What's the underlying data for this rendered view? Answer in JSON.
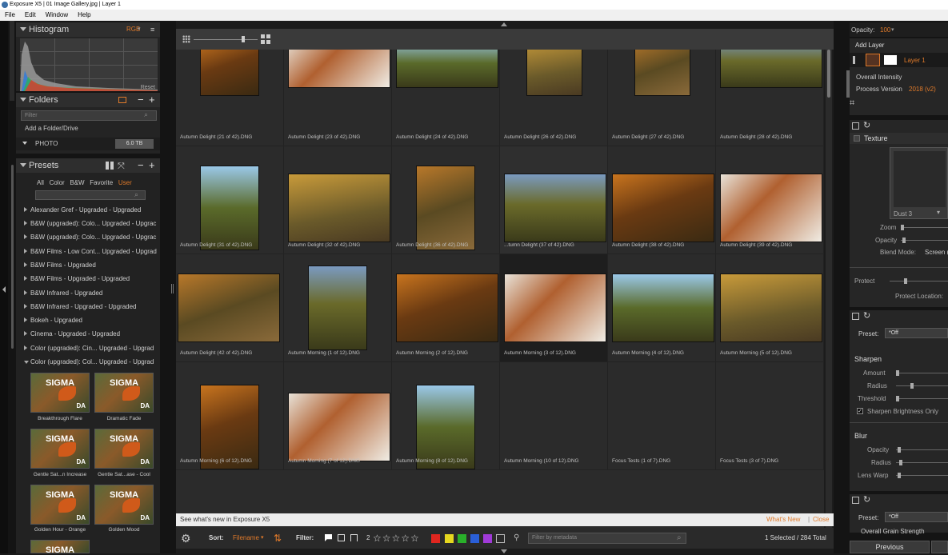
{
  "window": {
    "title": "Exposure X5 | 01 Image Gallery.jpg | Layer 1"
  },
  "menu": [
    "File",
    "Edit",
    "Window",
    "Help"
  ],
  "histogram": {
    "title": "Histogram",
    "mode": "RGB",
    "reset": "Reset"
  },
  "folders": {
    "title": "Folders",
    "filter_placeholder": "Filter",
    "add": "Add a Folder/Drive",
    "drive_name": "PHOTO",
    "drive_size": "6.0 TB"
  },
  "presets": {
    "title": "Presets",
    "tabs": [
      "All",
      "Color",
      "B&W",
      "Favorite",
      "User"
    ],
    "groups": [
      "Alexander Gref - Upgraded - Upgraded",
      "B&W (upgraded): Colo... Upgraded - Upgrac",
      "B&W (upgraded): Colo... Upgraded - Upgrac",
      "B&W Films - Low Cont... Upgraded - Upgrad",
      "B&W Films - Upgraded",
      "B&W Films - Upgraded - Upgraded",
      "B&W Infrared - Upgraded",
      "B&W Infrared - Upgraded - Upgraded",
      "Bokeh - Upgraded",
      "Cinema - Upgraded - Upgraded",
      "Color (upgraded): Cin... Upgraded - Upgrad",
      "Color (upgraded): Col... Upgraded - Upgrad"
    ],
    "thumbs": [
      {
        "label": "Breakthrough Flare"
      },
      {
        "label": "Dramatic Fade"
      },
      {
        "label": "Gentle Sat...n Increase"
      },
      {
        "label": "Gentle Sat...ase - Cool"
      },
      {
        "label": "Golden Hour - Orange"
      },
      {
        "label": "Golden Mood"
      }
    ],
    "thumb_text": {
      "brand": "SIGMA",
      "badge": "DA"
    }
  },
  "grid": {
    "rows": [
      [
        "Autumn Delight (21 of 42).DNG",
        "Autumn Delight (23 of 42).DNG",
        "Autumn Delight (24 of 42).DNG",
        "Autumn Delight (26 of 42).DNG",
        "Autumn Delight (27 of 42).DNG",
        "Autumn Delight (28 of 42).DNG"
      ],
      [
        "Autumn Delight (31 of 42).DNG",
        "Autumn Delight (32 of 42).DNG",
        "Autumn Delight (36 of 42).DNG",
        "...tumn Delight (37 of 42).DNG",
        "Autumn Delight (38 of 42).DNG",
        "Autumn Delight (39 of 42).DNG"
      ],
      [
        "Autumn Delight (42 of 42).DNG",
        "Autumn Morning (1 of 12).DNG",
        "Autumn Morning (2 of 12).DNG",
        "Autumn Morning (3 of 12).DNG",
        "Autumn Morning (4 of 12).DNG",
        "Autumn Morning (5 of 12).DNG"
      ],
      [
        "Autumn Morning (6 of 12).DNG",
        "Autumn Morning (7 of 12).DNG",
        "Autumn Morning (8 of 12).DNG",
        "Autumn Morning (10 of 12).DNG",
        "Focus Tests (1 of 7).DNG",
        "Focus Tests (3 of 7).DNG"
      ]
    ],
    "stars": "☆☆☆☆☆"
  },
  "news": {
    "text": "See what's new in Exposure X5",
    "link": "What's New",
    "close": "Close"
  },
  "bottom": {
    "sort_label": "Sort:",
    "sort_value": "Filename",
    "filter_label": "Filter:",
    "rating_count": "2",
    "stars": "☆☆☆☆☆",
    "meta_placeholder": "Filter by metadata",
    "status": "1 Selected / 284 Total",
    "colors": [
      "#e0261f",
      "#e5d71f",
      "#29b02a",
      "#2a5fd8",
      "#a03ad8"
    ]
  },
  "right": {
    "opacity_label": "Opacity:",
    "opacity_value": "100",
    "add_layer": "Add Layer",
    "layer_name": "Layer 1",
    "overall_intensity": "Overall Intensity",
    "process_version": "Process Version",
    "process_value": "2018 (v2)",
    "texture": {
      "title": "Texture",
      "preset": "Dust 3",
      "zoom": "Zoom",
      "opacity": "Opacity",
      "blend_label": "Blend Mode:",
      "blend_value": "Screen (I",
      "protect": "Protect",
      "protect_location": "Protect Location:"
    },
    "preset_label": "Preset:",
    "preset_value": "*Off",
    "sharpen": {
      "title": "Sharpen",
      "amount": "Amount",
      "radius": "Radius",
      "threshold": "Threshold",
      "brightness_only": "Sharpen Brightness Only"
    },
    "blur": {
      "title": "Blur",
      "opacity": "Opacity",
      "radius": "Radius",
      "lens_warp": "Lens Warp"
    },
    "grain_preset_label": "Preset:",
    "grain_preset_value": "*Off",
    "grain_strength": "Overall Grain Strength",
    "previous": "Previous"
  }
}
